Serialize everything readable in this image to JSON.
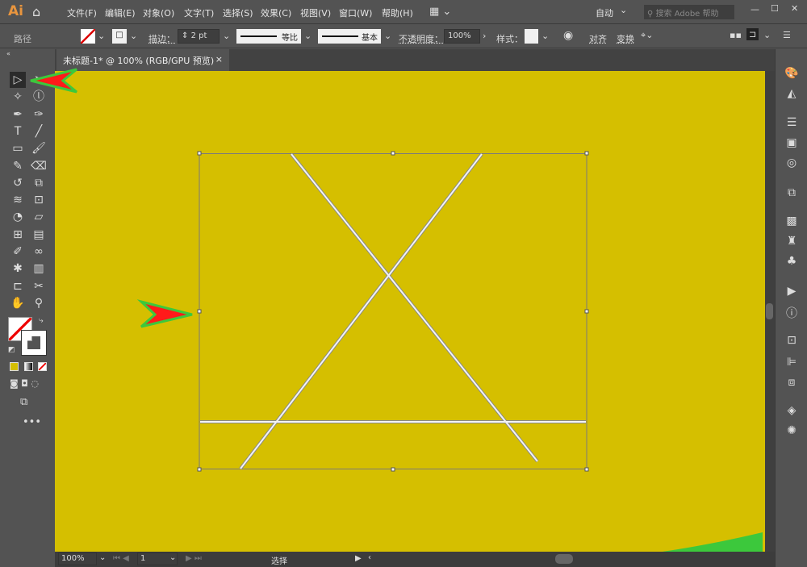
{
  "app": {
    "logo": "Ai",
    "menus": [
      "文件(F)",
      "编辑(E)",
      "对象(O)",
      "文字(T)",
      "选择(S)",
      "效果(C)",
      "视图(V)",
      "窗口(W)",
      "帮助(H)"
    ],
    "workspace": "自动",
    "search_placeholder": "搜索 Adobe 帮助"
  },
  "control": {
    "selection_type": "路径",
    "stroke_label": "描边：",
    "stroke_weight": "2 pt",
    "profile": "等比",
    "brush": "基本",
    "opacity_label": "不透明度：",
    "opacity": "100%",
    "style_label": "样式：",
    "align": "对齐",
    "transform": "变换"
  },
  "document": {
    "tab_title": "未标题-1* @ 100% (RGB/GPU 预览)",
    "close": "×"
  },
  "status": {
    "zoom": "100%",
    "artboard": "1",
    "tool": "选择"
  },
  "colors": {
    "canvas": "#d5bf00",
    "annotation_arrow": "#ff1a1a",
    "annotation_outline": "#3cc83c"
  },
  "tools": [
    "selection",
    "direct-selection",
    "magic-wand",
    "lasso",
    "pen",
    "curvature",
    "type",
    "line",
    "rectangle",
    "paintbrush",
    "shaper",
    "eraser",
    "rotate",
    "scale",
    "warp",
    "free-transform",
    "shape-builder",
    "perspective",
    "mesh",
    "gradient",
    "eyedropper",
    "blend",
    "symbol-sprayer",
    "graph",
    "artboard",
    "slice",
    "hand",
    "zoom"
  ]
}
